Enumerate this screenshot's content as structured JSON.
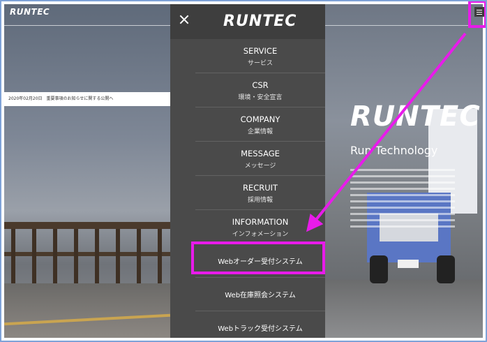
{
  "site": {
    "logo": "RUNTEC",
    "notice": "2020年02月20日　重要事項のお知らせに関する公開へ",
    "brand_big": "RUNTEC",
    "brand_sub": "Run Technology"
  },
  "menu": {
    "logo": "RUNTEC",
    "close_icon": "close-icon",
    "items": [
      {
        "en": "SERVICE",
        "jp": "サービス"
      },
      {
        "en": "CSR",
        "jp": "環境・安全宣言"
      },
      {
        "en": "COMPANY",
        "jp": "企業情報"
      },
      {
        "en": "MESSAGE",
        "jp": "メッセージ"
      },
      {
        "en": "RECRUIT",
        "jp": "採用情報"
      },
      {
        "en": "INFORMATION",
        "jp": "インフォメーション"
      }
    ],
    "web_items": [
      "Webオーダー受付システム",
      "Web在庫照会システム",
      "Webトラック受付システム"
    ]
  },
  "annotations": {
    "highlight_color": "#e81bea"
  }
}
